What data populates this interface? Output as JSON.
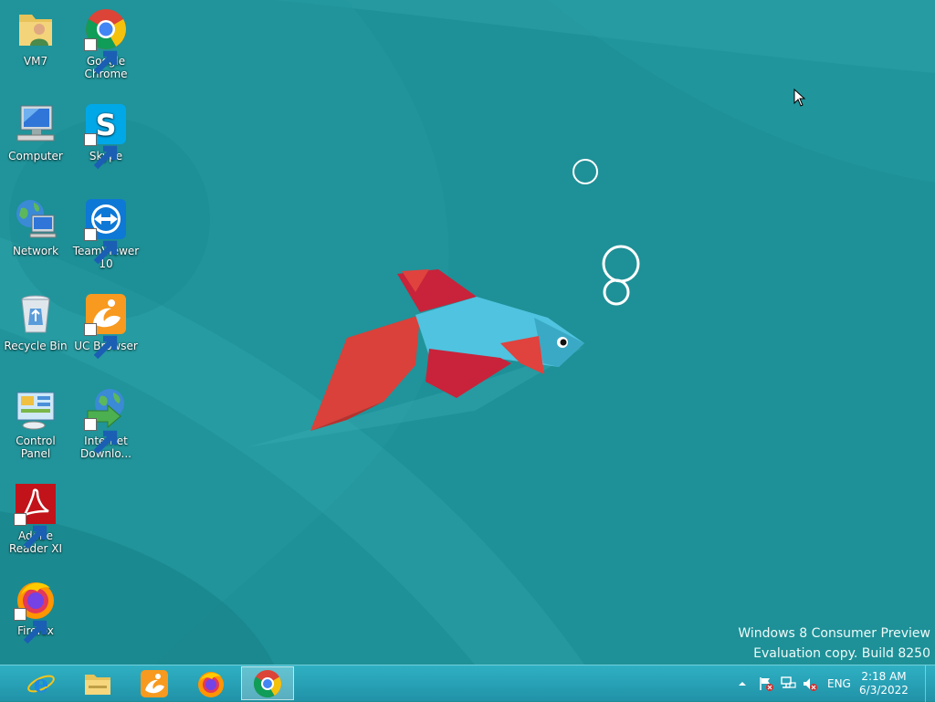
{
  "desktop": {
    "icons": [
      {
        "label": "VM7",
        "icon": "user-folder-icon"
      },
      {
        "label": "Google Chrome",
        "icon": "chrome-icon",
        "shortcut": true
      },
      {
        "label": "Computer",
        "icon": "computer-icon"
      },
      {
        "label": "Skype",
        "icon": "skype-icon",
        "shortcut": true
      },
      {
        "label": "Network",
        "icon": "network-icon"
      },
      {
        "label": "TeamViewer 10",
        "icon": "teamviewer-icon",
        "shortcut": true
      },
      {
        "label": "Recycle Bin",
        "icon": "recycle-bin-icon"
      },
      {
        "label": "UC Browser",
        "icon": "uc-browser-icon",
        "shortcut": true
      },
      {
        "label": "Control Panel",
        "icon": "control-panel-icon"
      },
      {
        "label": "Internet Downlo...",
        "icon": "internet-download-manager-icon",
        "shortcut": true
      },
      {
        "label": "Adobe Reader XI",
        "icon": "adobe-reader-icon",
        "shortcut": true
      },
      {
        "label": "Firefox",
        "icon": "firefox-icon",
        "shortcut": true
      }
    ]
  },
  "watermark": {
    "line1": "Windows 8 Consumer Preview",
    "line2": "Evaluation copy. Build 8250"
  },
  "taskbar": {
    "pinned": [
      {
        "name": "internet-explorer",
        "icon": "internet-explorer-icon"
      },
      {
        "name": "file-explorer",
        "icon": "file-explorer-icon"
      },
      {
        "name": "uc-browser",
        "icon": "uc-browser-icon"
      },
      {
        "name": "firefox",
        "icon": "firefox-icon"
      },
      {
        "name": "chrome",
        "icon": "chrome-icon",
        "active": true
      }
    ],
    "tray": {
      "language": "ENG",
      "time": "2:18 AM",
      "date": "6/3/2022"
    }
  },
  "colors": {
    "wallpaper": "#1d8f96",
    "taskbar": "#2aa6ba",
    "fish_body": "#4fc3df",
    "fish_fins": "#c8233a",
    "fish_tail": "#d9413a"
  }
}
